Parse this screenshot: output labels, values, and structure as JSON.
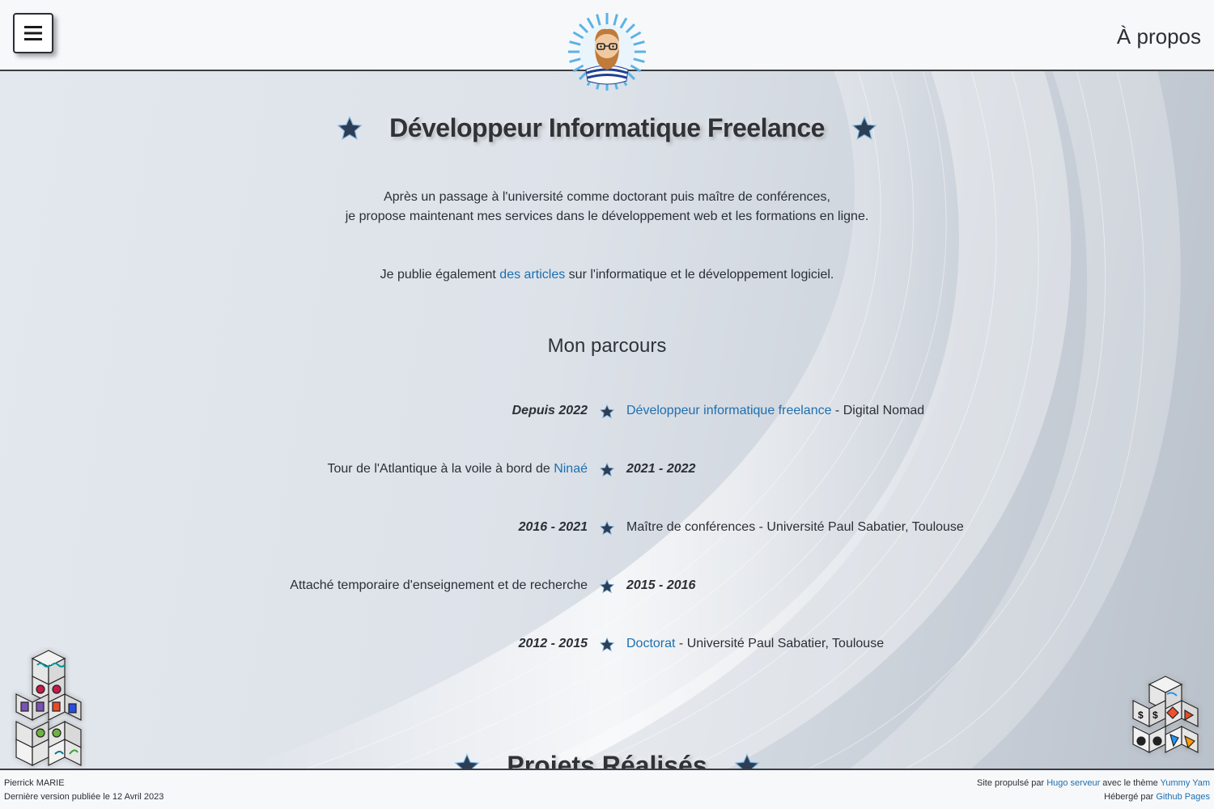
{
  "header": {
    "menu_icon": "hamburger-icon",
    "about_label": "À propos",
    "logo_icon": "bearded-developer-avatar"
  },
  "hero": {
    "title": "Développeur Informatique Freelance",
    "intro_line1": "Après un passage à l'université comme doctorant puis maître de conférences,",
    "intro_line2": "je propose maintenant mes services dans le développement web et les formations en ligne.",
    "articles_before": "Je publie également ",
    "articles_link": "des articles",
    "articles_after": " sur l'informatique et le développement logiciel."
  },
  "parcours": {
    "title": "Mon parcours",
    "items": [
      {
        "year": "Depuis 2022",
        "link": "Développeur informatique freelance",
        "text": " - Digital Nomad",
        "side": "right"
      },
      {
        "year": "2021 - 2022",
        "text_before": "Tour de l'Atlantique à la voile à bord de ",
        "link": "Ninaé",
        "side": "left"
      },
      {
        "year": "2016 - 2021",
        "text": "Maître de conférences - Université Paul Sabatier, Toulouse",
        "side": "right"
      },
      {
        "year": "2015 - 2016",
        "text": "Attaché temporaire d'enseignement et de recherche",
        "side": "left"
      },
      {
        "year": "2012 - 2015",
        "link": "Doctorat",
        "text": " - Université Paul Sabatier, Toulouse",
        "side": "right"
      }
    ]
  },
  "projects": {
    "title": "Projets Réalisés"
  },
  "footer": {
    "author": "Pierrick MARIE",
    "version": "Dernière version publiée le 12 Avril 2023",
    "powered_before": "Site propulsé par ",
    "powered_link": "Hugo serveur",
    "powered_middle": " avec le thème ",
    "theme_link": "Yummy Yam",
    "hosted_before": "Hébergé par ",
    "hosted_link": "Github Pages"
  },
  "colors": {
    "accent_link": "#1d6fae",
    "star": "#2c3e55",
    "header_bg": "#f7f8fa"
  }
}
